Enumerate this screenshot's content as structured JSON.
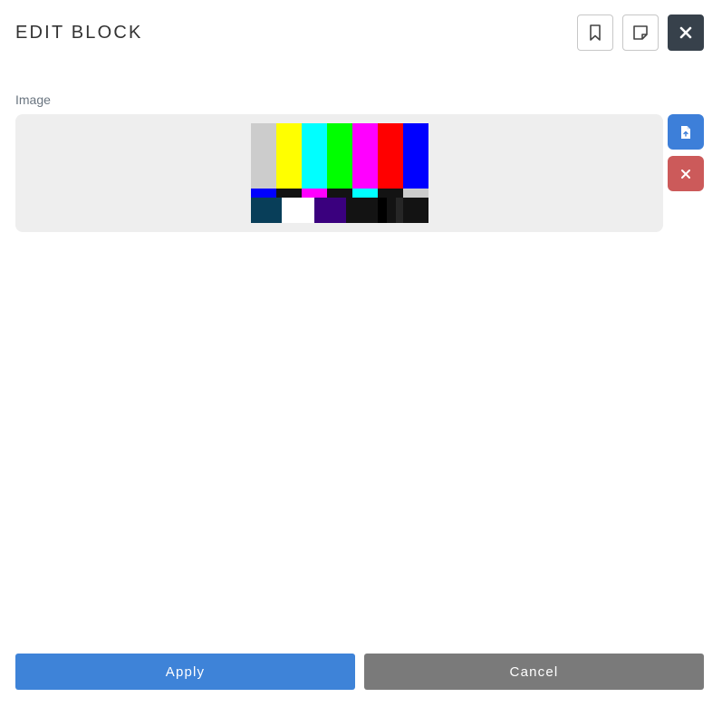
{
  "header": {
    "title": "EDIT BLOCK"
  },
  "field": {
    "label": "Image"
  },
  "footer": {
    "apply_label": "Apply",
    "cancel_label": "Cancel"
  },
  "icons": {
    "bookmark": "bookmark-icon",
    "note": "sticky-note-icon",
    "close": "close-icon",
    "upload": "file-upload-icon",
    "remove": "remove-icon"
  },
  "colors": {
    "primary": "#3e83d8",
    "danger": "#cc5a5a",
    "dark": "#37414b",
    "neutral": "#7a7a7a"
  }
}
